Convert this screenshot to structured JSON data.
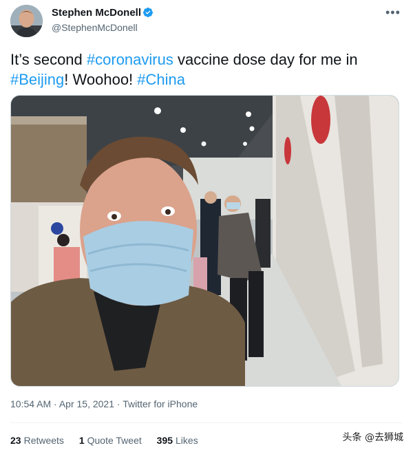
{
  "author": {
    "name": "Stephen McDonell",
    "handle": "@StephenMcDonell",
    "verified_icon": "verified-badge-icon",
    "more_icon": "more-options-icon"
  },
  "tweet": {
    "text_parts": [
      {
        "text": "It’s second ",
        "hashtag": false
      },
      {
        "text": "#coronavirus",
        "hashtag": true
      },
      {
        "text": " vaccine dose day for me in ",
        "hashtag": false
      },
      {
        "text": "#Beijing",
        "hashtag": true
      },
      {
        "text": "! Woohoo! ",
        "hashtag": false
      },
      {
        "text": "#China",
        "hashtag": true
      }
    ],
    "time": "10:54 AM",
    "separator1": " · ",
    "date": "Apr 15, 2021",
    "separator2": " · ",
    "source": "Twitter for iPhone"
  },
  "stats": {
    "retweets_count": "23",
    "retweets_label": "Retweets",
    "quotes_count": "1",
    "quotes_label": "Quote Tweet",
    "likes_count": "395",
    "likes_label": "Likes"
  },
  "watermark": "头条 @去狮城",
  "colors": {
    "hashtag": "#1d9bf0",
    "verified": "#1d9bf0",
    "secondary_text": "#536471"
  }
}
